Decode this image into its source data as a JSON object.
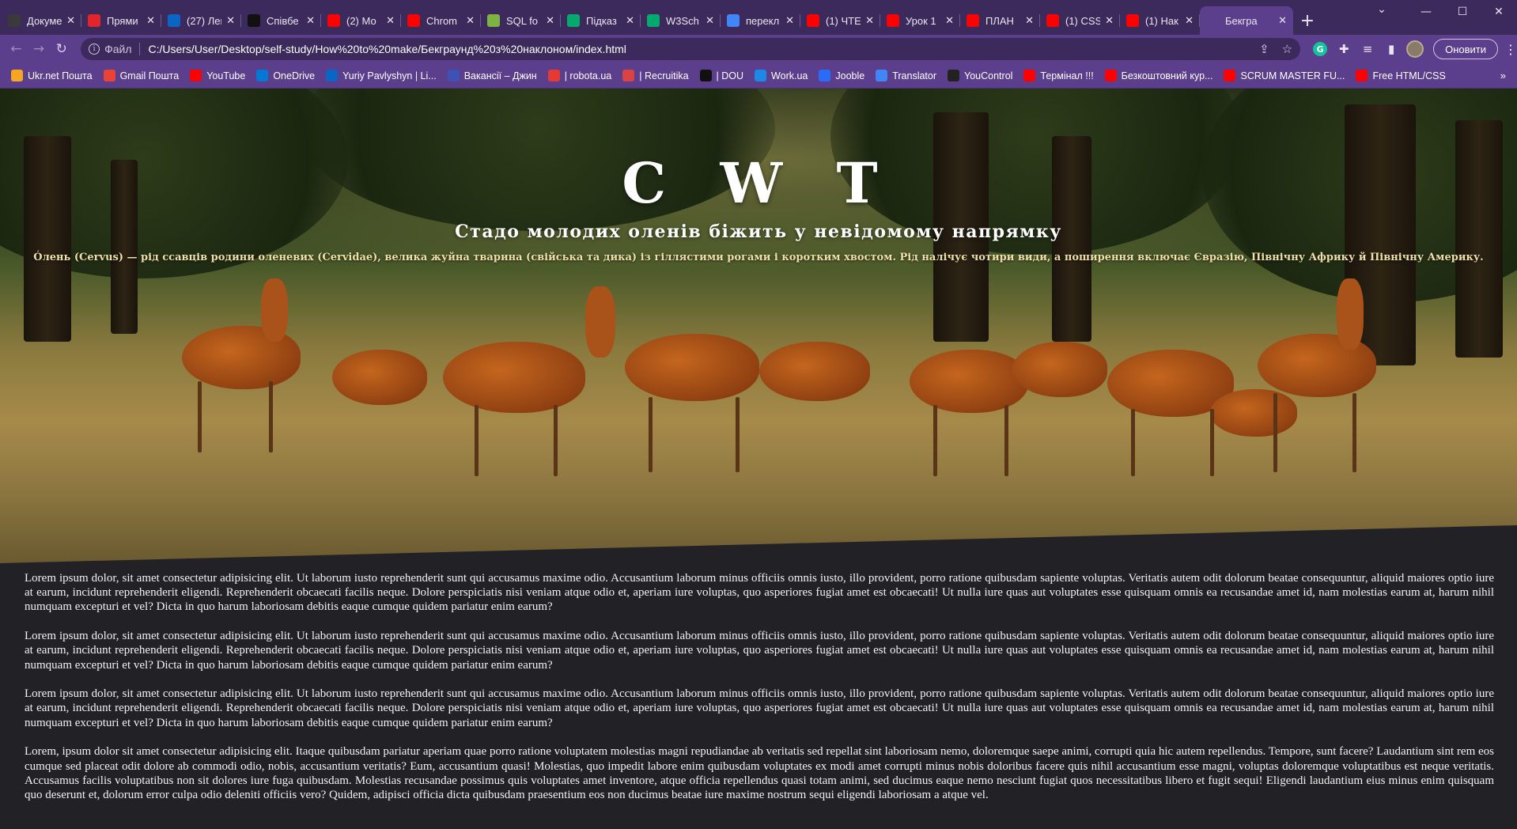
{
  "browser": {
    "tabs": [
      {
        "title": "Докуме",
        "favicon": "ko-icon",
        "color": "#3a3a3a"
      },
      {
        "title": "Прями",
        "favicon": "24-icon",
        "color": "#e0252b"
      },
      {
        "title": "(27) Лен",
        "favicon": "linkedin-icon",
        "color": "#0a66c2"
      },
      {
        "title": "Співбе",
        "favicon": "dou-icon",
        "color": "#111111"
      },
      {
        "title": "(2) Мо",
        "favicon": "youtube-icon",
        "color": "#ff0000"
      },
      {
        "title": "Chrom",
        "favicon": "youtube-icon",
        "color": "#ff0000"
      },
      {
        "title": "SQL fo",
        "favicon": "m-icon",
        "color": "#7cb342"
      },
      {
        "title": "Підказ",
        "favicon": "w3-icon",
        "color": "#04aa6d"
      },
      {
        "title": "W3Sch",
        "favicon": "w3-icon",
        "color": "#04aa6d"
      },
      {
        "title": "перекл",
        "favicon": "google-icon",
        "color": "#4285f4"
      },
      {
        "title": "(1) ЧТЕ",
        "favicon": "youtube-icon",
        "color": "#ff0000"
      },
      {
        "title": "Урок 1",
        "favicon": "youtube-icon",
        "color": "#ff0000"
      },
      {
        "title": "ПЛАН",
        "favicon": "youtube-icon",
        "color": "#ff0000"
      },
      {
        "title": "(1) CSS",
        "favicon": "youtube-icon",
        "color": "#ff0000"
      },
      {
        "title": "(1) Нак",
        "favicon": "youtube-icon",
        "color": "#ff0000"
      },
      {
        "title": "Бекгра",
        "favicon": "globe-icon",
        "color": "#5b3e8c",
        "active": true
      }
    ],
    "new_tab": "+",
    "address": {
      "scheme": "Файл",
      "url": "C:/Users/User/Desktop/self-study/How%20to%20make/Бекграунд%20з%20наклоном/index.html"
    },
    "update_button": "Оновити",
    "bookmarks": [
      {
        "label": "Ukr.net Пошта",
        "favicon": "ukrnet-icon",
        "color": "#f5a623"
      },
      {
        "label": "Gmail Пошта",
        "favicon": "gmail-icon",
        "color": "#ea4335"
      },
      {
        "label": "YouTube",
        "favicon": "youtube-icon",
        "color": "#ff0000"
      },
      {
        "label": "OneDrive",
        "favicon": "onedrive-icon",
        "color": "#0078d4"
      },
      {
        "label": "Yuriy Pavlyshyn | Li...",
        "favicon": "linkedin-icon",
        "color": "#0a66c2"
      },
      {
        "label": "Вакансії – Джин",
        "favicon": "djinni-icon",
        "color": "#3f51b5"
      },
      {
        "label": "| robota.ua",
        "favicon": "robota-icon",
        "color": "#e53935"
      },
      {
        "label": "| Recruitika",
        "favicon": "recruitika-icon",
        "color": "#d84343"
      },
      {
        "label": "| DOU",
        "favicon": "dou-icon",
        "color": "#111111"
      },
      {
        "label": "Work.ua",
        "favicon": "workua-icon",
        "color": "#1e88e5"
      },
      {
        "label": "Jooble",
        "favicon": "jooble-icon",
        "color": "#2b6cf6"
      },
      {
        "label": "Translator",
        "favicon": "google-icon",
        "color": "#4285f4"
      },
      {
        "label": "YouControl",
        "favicon": "youcontrol-icon",
        "color": "#222222"
      },
      {
        "label": "Термінал !!!",
        "favicon": "youtube-icon",
        "color": "#ff0000"
      },
      {
        "label": "Безкоштовний кур...",
        "favicon": "youtube-icon",
        "color": "#ff0000"
      },
      {
        "label": "SCRUM MASTER FU...",
        "favicon": "youtube-icon",
        "color": "#ff0000"
      },
      {
        "label": "Free HTML/CSS",
        "favicon": "youtube-icon",
        "color": "#ff0000"
      }
    ]
  },
  "page": {
    "hero": {
      "title": "C W T",
      "subtitle": "Стадо молодих оленів біжить у невідомому напрямку",
      "description": "Óлень (Cervus) — рід ссавців родини оленевих (Cervidae), велика жуйна тварина (свійська та дика) із гіллястими рогами і коротким хвостом. Рід налічує чотири види, а поширення включає Євразію, Північну Африку й Північну Америку."
    },
    "paragraphs": [
      "Lorem ipsum dolor, sit amet consectetur adipisicing elit. Ut laborum iusto reprehenderit sunt qui accusamus maxime odio. Accusantium laborum minus officiis omnis iusto, illo provident, porro ratione quibusdam sapiente voluptas. Veritatis autem odit dolorum beatae consequuntur, aliquid maiores optio iure at earum, incidunt reprehenderit eligendi. Reprehenderit obcaecati facilis neque. Dolore perspiciatis nisi veniam atque odio et, aperiam iure voluptas, quo asperiores fugiat amet est obcaecati! Ut nulla iure quas aut voluptates esse quisquam omnis ea recusandae amet id, nam molestias earum at, harum nihil numquam excepturi et vel? Dicta in quo harum laboriosam debitis eaque cumque quidem pariatur enim earum?",
      "Lorem ipsum dolor, sit amet consectetur adipisicing elit. Ut laborum iusto reprehenderit sunt qui accusamus maxime odio. Accusantium laborum minus officiis omnis iusto, illo provident, porro ratione quibusdam sapiente voluptas. Veritatis autem odit dolorum beatae consequuntur, aliquid maiores optio iure at earum, incidunt reprehenderit eligendi. Reprehenderit obcaecati facilis neque. Dolore perspiciatis nisi veniam atque odio et, aperiam iure voluptas, quo asperiores fugiat amet est obcaecati! Ut nulla iure quas aut voluptates esse quisquam omnis ea recusandae amet id, nam molestias earum at, harum nihil numquam excepturi et vel? Dicta in quo harum laboriosam debitis eaque cumque quidem pariatur enim earum?",
      "Lorem ipsum dolor, sit amet consectetur adipisicing elit. Ut laborum iusto reprehenderit sunt qui accusamus maxime odio. Accusantium laborum minus officiis omnis iusto, illo provident, porro ratione quibusdam sapiente voluptas. Veritatis autem odit dolorum beatae consequuntur, aliquid maiores optio iure at earum, incidunt reprehenderit eligendi. Reprehenderit obcaecati facilis neque. Dolore perspiciatis nisi veniam atque odio et, aperiam iure voluptas, quo asperiores fugiat amet est obcaecati! Ut nulla iure quas aut voluptates esse quisquam omnis ea recusandae amet id, nam molestias earum at, harum nihil numquam excepturi et vel? Dicta in quo harum laboriosam debitis eaque cumque quidem pariatur enim earum?",
      "Lorem, ipsum dolor sit amet consectetur adipisicing elit. Itaque quibusdam pariatur aperiam quae porro ratione voluptatem molestias magni repudiandae ab veritatis sed repellat sint laboriosam nemo, doloremque saepe animi, corrupti quia hic autem repellendus. Tempore, sunt facere? Laudantium sint rem eos cumque sed placeat odit dolore ab commodi odio, nobis, accusantium veritatis? Eum, accusantium quasi! Molestias, quo impedit labore enim quibusdam voluptates ex modi amet corrupti minus nobis doloribus facere quis nihil accusantium esse magni, voluptas doloremque voluptatibus est neque veritatis. Accusamus facilis voluptatibus non sit dolores iure fuga quibusdam. Molestias recusandae possimus quis voluptates amet inventore, atque officia repellendus quasi totam animi, sed ducimus eaque nemo nesciunt fugiat quos necessitatibus libero et fugit sequi! Eligendi laudantium eius minus enim quisquam quo deserunt et, dolorum error culpa odio deleniti officiis vero? Quidem, adipisci officia dicta quibusdam praesentium eos non ducimus beatae iure maxime nostrum sequi eligendi laboriosam a atque vel."
    ]
  }
}
